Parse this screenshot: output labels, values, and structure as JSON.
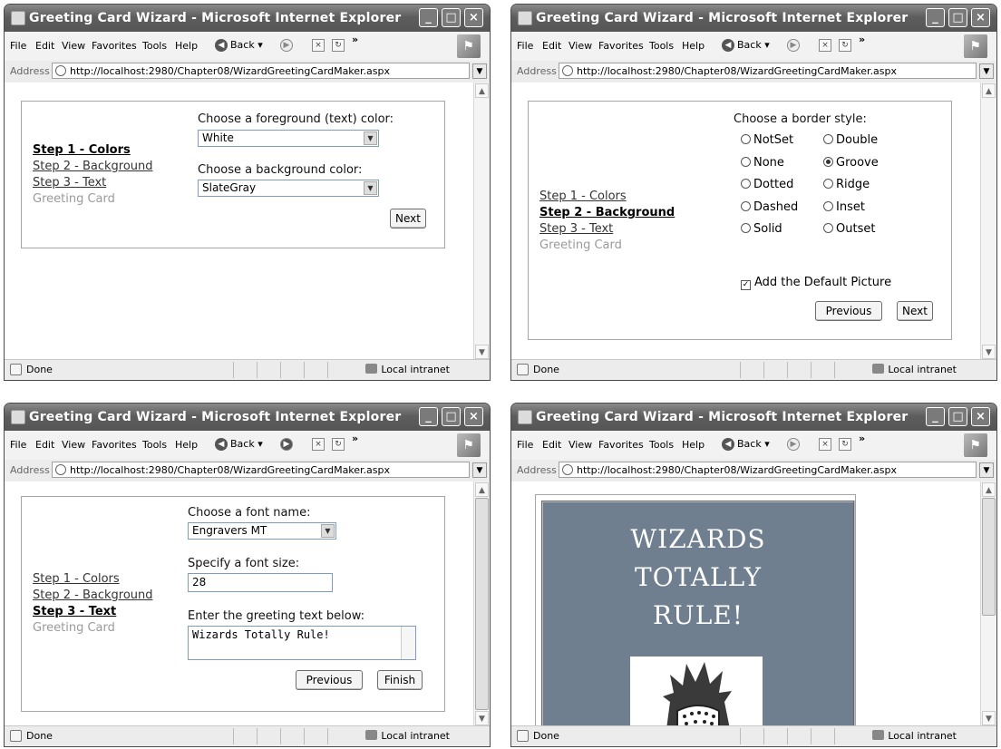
{
  "browser": {
    "title": "Greeting Card Wizard - Microsoft Internet Explorer",
    "menu": [
      "File",
      "Edit",
      "View",
      "Favorites",
      "Tools",
      "Help"
    ],
    "back_label": "Back",
    "address_label": "Address",
    "url": "http://localhost:2980/Chapter08/WizardGreetingCardMaker.aspx",
    "status": "Done",
    "zone": "Local intranet"
  },
  "steps": [
    "Step 1 - Colors",
    "Step 2 - Background",
    "Step 3 - Text",
    "Greeting Card"
  ],
  "step1": {
    "fg_label": "Choose a foreground (text) color:",
    "fg_value": "White",
    "bg_label": "Choose a background color:",
    "bg_value": "SlateGray",
    "next": "Next"
  },
  "step2": {
    "border_label": "Choose a border style:",
    "options_left": [
      "NotSet",
      "None",
      "Dotted",
      "Dashed",
      "Solid"
    ],
    "options_right": [
      "Double",
      "Groove",
      "Ridge",
      "Inset",
      "Outset"
    ],
    "selected": "Groove",
    "picture_label": "Add the Default Picture",
    "previous": "Previous",
    "next": "Next"
  },
  "step3": {
    "font_label": "Choose a font name:",
    "font_value": "Engravers MT",
    "size_label": "Specify a font size:",
    "size_value": "28",
    "text_label": "Enter the greeting text below:",
    "text_value": "Wizards Totally Rule!",
    "previous": "Previous",
    "finish": "Finish"
  },
  "card": {
    "line1": "WIZARDS",
    "line2": "TOTALLY",
    "line3": "RULE!",
    "bg_color": "#6f7f8f"
  }
}
